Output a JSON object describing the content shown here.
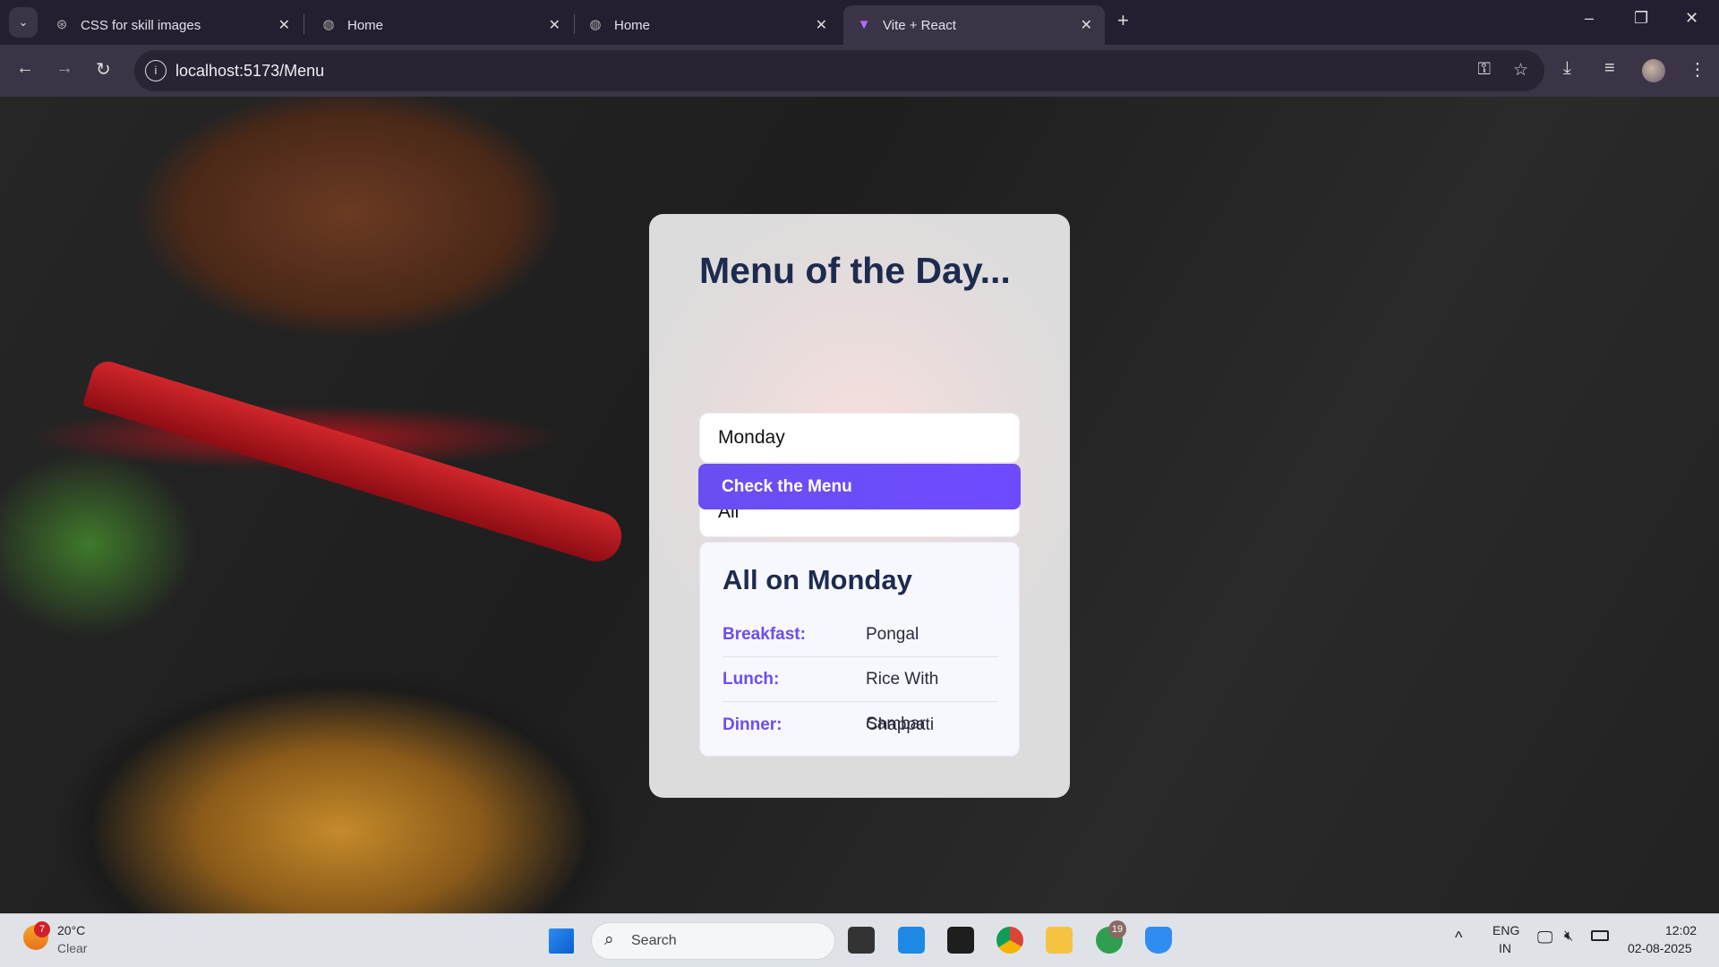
{
  "browser": {
    "tabs": [
      {
        "title": "CSS for skill images",
        "icon": "openai-icon",
        "active": false
      },
      {
        "title": "Home",
        "icon": "globe-icon",
        "active": false
      },
      {
        "title": "Home",
        "icon": "globe-icon",
        "active": false
      },
      {
        "title": "Vite + React",
        "icon": "vite-icon",
        "active": true
      }
    ],
    "url": "localhost:5173/Menu"
  },
  "page": {
    "title": "Menu of the Day...",
    "day_select": "Monday",
    "meal_select": "All",
    "button_label": "Check the Menu",
    "result": {
      "heading": "All on Monday",
      "rows": [
        {
          "label": "Breakfast:",
          "value": "Pongal"
        },
        {
          "label": "Lunch:",
          "value": "Rice With Sambar"
        },
        {
          "label": "Dinner:",
          "value": "Chappati"
        }
      ]
    },
    "colors": {
      "accent": "#6b4ef0",
      "heading": "#1d2b4f"
    }
  },
  "taskbar": {
    "weather_temp": "20°C",
    "weather_desc": "Clear",
    "weather_badge": "7",
    "search_placeholder": "Search",
    "whatsapp_badge": "19",
    "lang": "ENG",
    "region": "IN",
    "time": "12:02",
    "date": "02-08-2025"
  }
}
